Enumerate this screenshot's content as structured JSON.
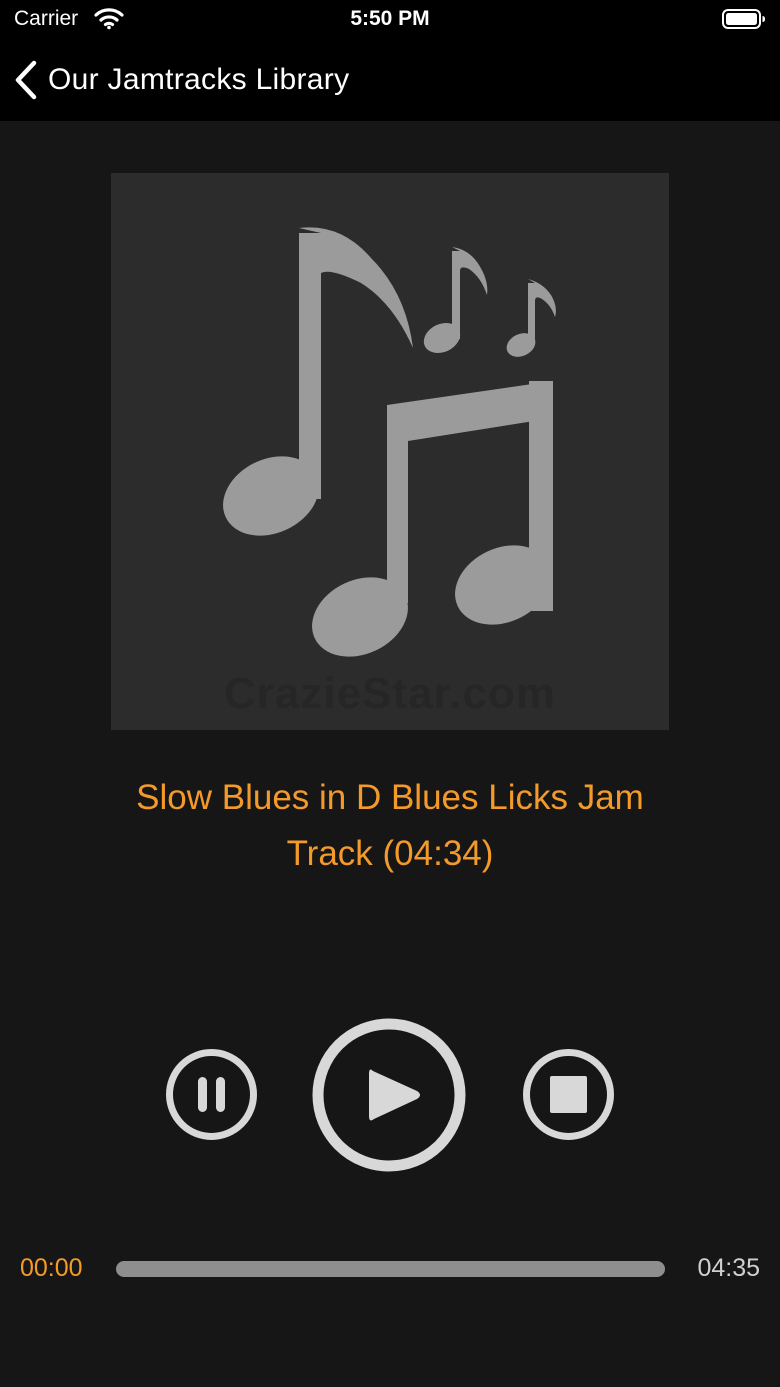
{
  "status_bar": {
    "carrier": "Carrier",
    "time": "5:50 PM",
    "icons": [
      "wifi-icon",
      "battery-icon"
    ]
  },
  "nav": {
    "back_icon": "chevron-left-icon",
    "back_label": "Our Jamtracks Library"
  },
  "artwork": {
    "icon": "music-notes-icon",
    "watermark": "CrazieStar.com"
  },
  "track": {
    "title": "Slow Blues in D Blues Licks Jam Track (04:34)"
  },
  "controls": {
    "pause_icon": "pause-icon",
    "play_icon": "play-icon",
    "stop_icon": "stop-icon"
  },
  "progress": {
    "current": "00:00",
    "duration": "04:35",
    "fraction": 0
  },
  "colors": {
    "accent": "#f39a2b",
    "background": "#161616",
    "bar": "#000000",
    "control": "#d8d8d8"
  }
}
